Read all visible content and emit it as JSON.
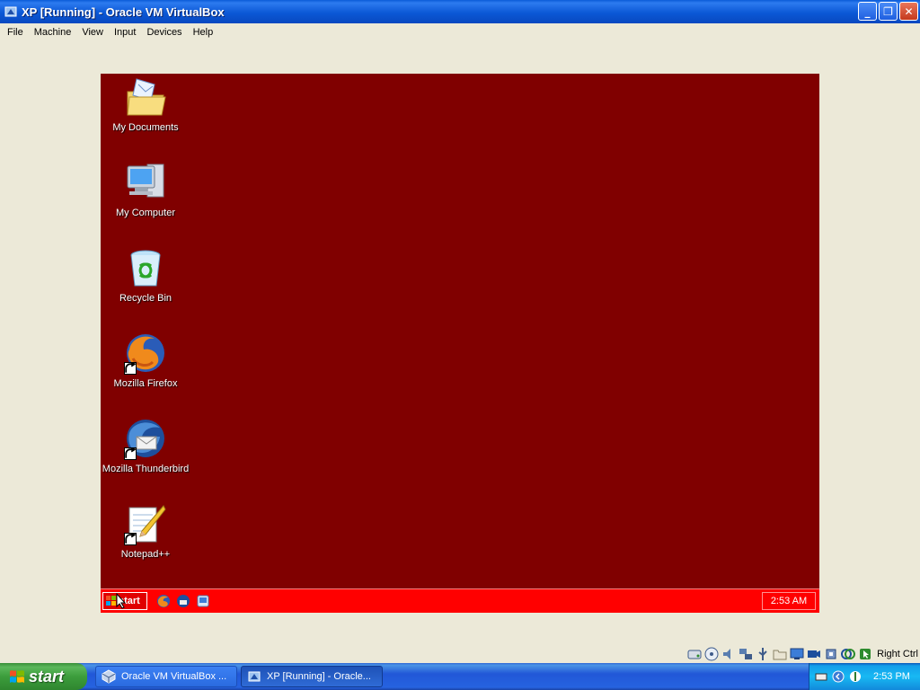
{
  "window": {
    "title": "XP [Running] - Oracle VM VirtualBox",
    "minimize_label": "_",
    "restore_label": "❐",
    "close_label": "✕"
  },
  "menu": {
    "items": [
      {
        "label": "File"
      },
      {
        "label": "Machine"
      },
      {
        "label": "View"
      },
      {
        "label": "Input"
      },
      {
        "label": "Devices"
      },
      {
        "label": "Help"
      }
    ]
  },
  "guest": {
    "desktop_color": "#800000",
    "icons": [
      {
        "label": "My Documents",
        "icon": "my-documents-icon"
      },
      {
        "label": "My Computer",
        "icon": "my-computer-icon"
      },
      {
        "label": "Recycle Bin",
        "icon": "recycle-bin-icon"
      },
      {
        "label": "Mozilla Firefox",
        "icon": "firefox-icon",
        "shortcut": true
      },
      {
        "label": "Mozilla Thunderbird",
        "icon": "thunderbird-icon",
        "shortcut": true
      },
      {
        "label": "Notepad++",
        "icon": "notepadpp-icon",
        "shortcut": true
      }
    ],
    "taskbar": {
      "color": "#FF0000",
      "start_label": "start",
      "clock": "2:53 AM"
    }
  },
  "status": {
    "host_key": "Right Ctrl"
  },
  "host_taskbar": {
    "start_label": "start",
    "tasks": [
      {
        "label": "Oracle VM VirtualBox ...",
        "icon": "virtualbox-icon"
      },
      {
        "label": "XP [Running] - Oracle...",
        "icon": "vm-running-icon"
      }
    ],
    "clock": "2:53 PM"
  }
}
